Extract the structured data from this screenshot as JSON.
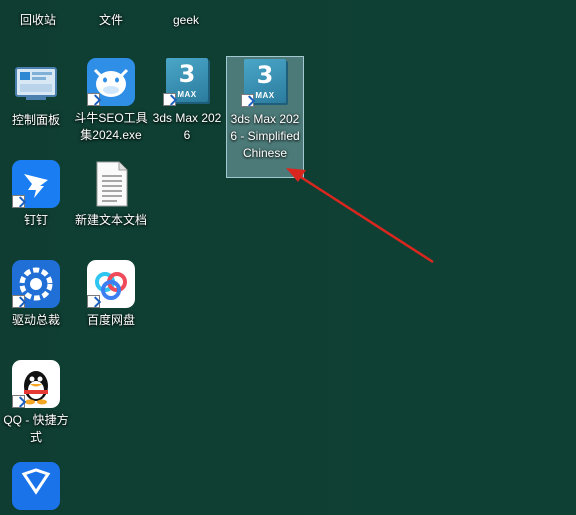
{
  "desktop": {
    "icons": [
      {
        "id": "recycle",
        "label": "回收站"
      },
      {
        "id": "file",
        "label": "文件"
      },
      {
        "id": "geek",
        "label": "geek"
      },
      {
        "id": "control",
        "label": "控制面板"
      },
      {
        "id": "seo",
        "label": "斗牛SEO工具集2024.exe"
      },
      {
        "id": "max1",
        "label": "3ds Max 2026",
        "tile_number": "3",
        "tile_sub": "MAX"
      },
      {
        "id": "max2",
        "label": "3ds Max 2026 - Simplified Chinese",
        "tile_number": "3",
        "tile_sub": "MAX"
      },
      {
        "id": "dingding",
        "label": "钉钉"
      },
      {
        "id": "newtxt",
        "label": "新建文本文档"
      },
      {
        "id": "driver",
        "label": "驱动总裁"
      },
      {
        "id": "baidu",
        "label": "百度网盘"
      },
      {
        "id": "qq",
        "label": "QQ - 快捷方式"
      }
    ]
  },
  "colors": {
    "desktop_bg": "#0f3f33",
    "arrow": "#d9271f",
    "selection": "#96c3cd"
  }
}
